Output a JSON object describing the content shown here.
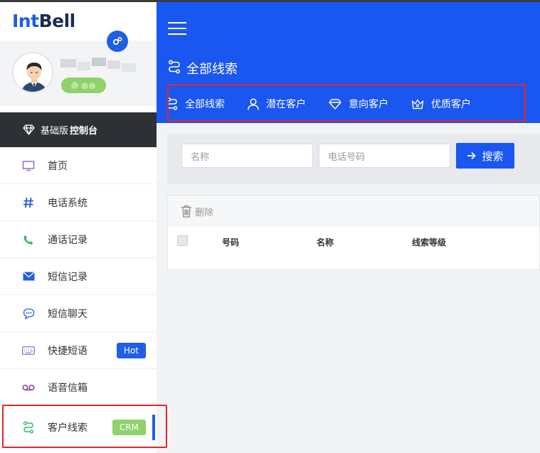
{
  "brand": {
    "name_part1": "Int",
    "name_part2": "Bell"
  },
  "profile": {
    "status_badge": "●●",
    "avatar_icon": "user-avatar"
  },
  "console": {
    "edition": "基础版",
    "label": "控制台",
    "icon": "diamond-icon"
  },
  "sidebar": {
    "items": [
      {
        "label": "首页",
        "icon": "monitor-icon"
      },
      {
        "label": "电话系统",
        "icon": "hash-icon"
      },
      {
        "label": "通话记录",
        "icon": "phone-icon"
      },
      {
        "label": "短信记录",
        "icon": "envelope-icon"
      },
      {
        "label": "短信聊天",
        "icon": "chat-bubble-icon"
      },
      {
        "label": "快捷短语",
        "icon": "keyboard-icon",
        "tag": "Hot"
      },
      {
        "label": "语音信箱",
        "icon": "voicemail-icon"
      },
      {
        "label": "客户线索",
        "icon": "route-icon",
        "tag": "CRM"
      }
    ]
  },
  "header": {
    "title": "全部线索"
  },
  "tabs": [
    {
      "label": "全部线索",
      "icon": "route-icon"
    },
    {
      "label": "潜在客户",
      "icon": "person-icon"
    },
    {
      "label": "意向客户",
      "icon": "gem-icon"
    },
    {
      "label": "优质客户",
      "icon": "crown-icon"
    }
  ],
  "search": {
    "name_placeholder": "名称",
    "phone_placeholder": "电话号码",
    "button_label": "搜索"
  },
  "table": {
    "delete_label": "删除",
    "columns": [
      "号码",
      "名称",
      "线索等级"
    ]
  },
  "colors": {
    "primary": "#1a56f0",
    "accent_green": "#8fd16a",
    "highlight_red": "#e3262b",
    "console_bg": "#2d3035"
  }
}
